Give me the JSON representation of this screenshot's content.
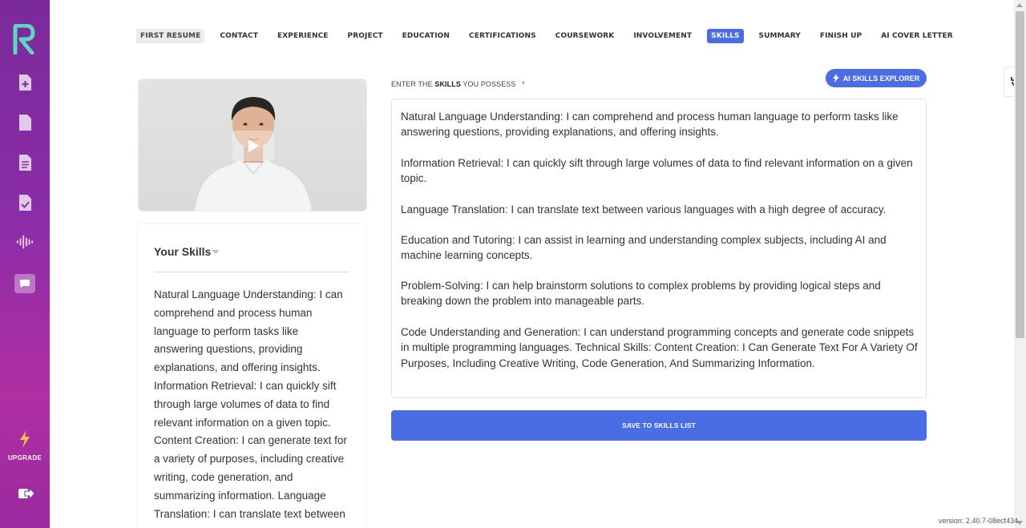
{
  "sidebar": {
    "logo": "resume-logo",
    "items": [
      {
        "icon": "add-document-icon"
      },
      {
        "icon": "document-icon"
      },
      {
        "icon": "text-document-icon"
      },
      {
        "icon": "checked-document-icon"
      },
      {
        "icon": "audio-wave-icon"
      },
      {
        "icon": "chat-bubble-icon"
      }
    ],
    "upgrade_label": "UPGRADE",
    "logout_icon": "logout-icon"
  },
  "nav": {
    "tabs": [
      {
        "label": "FIRST RESUME",
        "state": "first"
      },
      {
        "label": "CONTACT"
      },
      {
        "label": "EXPERIENCE"
      },
      {
        "label": "PROJECT"
      },
      {
        "label": "EDUCATION"
      },
      {
        "label": "CERTIFICATIONS"
      },
      {
        "label": "COURSEWORK"
      },
      {
        "label": "INVOLVEMENT"
      },
      {
        "label": "SKILLS",
        "state": "active"
      },
      {
        "label": "SUMMARY"
      },
      {
        "label": "FINISH UP"
      },
      {
        "label": "AI COVER LETTER"
      }
    ]
  },
  "skills_card": {
    "title": "Your Skills",
    "body": "Natural Language Understanding: I can comprehend and process human language to perform tasks like answering questions, providing explanations, and offering insights. Information Retrieval: I can quickly sift through large volumes of data to find relevant information on a given topic. Content Creation: I can generate text for a variety of purposes, including creative writing, code generation, and summarizing information. Language Translation: I can translate text between"
  },
  "editor": {
    "label_prefix": "ENTER THE ",
    "label_bold": "SKILLS",
    "label_suffix": " YOU POSSESS",
    "required_mark": "*",
    "ai_button": "AI SKILLS EXPLORER",
    "paragraphs": [
      "Natural Language Understanding: I can comprehend and process human language to perform tasks like answering questions, providing explanations, and offering insights.",
      "Information Retrieval: I can quickly sift through large volumes of data to find relevant information on a given topic.",
      "Language Translation: I can translate text between various languages with a high degree of accuracy.",
      "Education and Tutoring: I can assist in learning and understanding complex subjects, including AI and machine learning concepts.",
      "Problem-Solving: I can help brainstorm solutions to complex problems by providing logical steps and breaking down the problem into manageable parts.",
      "Code Understanding and Generation: I can understand programming concepts and generate code snippets in multiple programming languages. Technical Skills: Content Creation: I Can Generate Text For A Variety Of Purposes, Including Creative Writing, Code Generation, And Summarizing Information."
    ],
    "save_button": "SAVE TO SKILLS LIST"
  },
  "version": "version: 2.40.7-08ecf434",
  "colors": {
    "accent": "#4a6de5",
    "sidebar_top": "#7a2a9a",
    "sidebar_bottom": "#b02fa3",
    "logo": "#5fd6c2",
    "upgrade_icon": "#f6c64a"
  }
}
